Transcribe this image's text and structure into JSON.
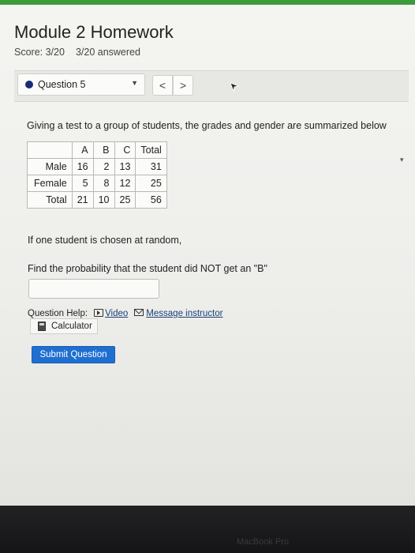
{
  "page": {
    "title": "Module 2 Homework",
    "score": "Score: 3/20",
    "answered": "3/20 answered"
  },
  "question_nav": {
    "selected": "Question 5",
    "caret": "▼",
    "prev": "<",
    "next": ">"
  },
  "question": {
    "intro": "Giving a test to a group of students, the grades and gender are summarized below",
    "table": {
      "headers": [
        "",
        "A",
        "B",
        "C",
        "Total"
      ],
      "rows": [
        [
          "Male",
          "16",
          "2",
          "13",
          "31"
        ],
        [
          "Female",
          "5",
          "8",
          "12",
          "25"
        ],
        [
          "Total",
          "21",
          "10",
          "25",
          "56"
        ]
      ]
    },
    "prompt1": "If one student is chosen at random,",
    "prompt2": "Find the probability that the student did NOT get an \"B\"",
    "answer_value": ""
  },
  "help": {
    "label": "Question Help:",
    "video": "Video",
    "message": "Message instructor",
    "calculator": "Calculator"
  },
  "submit_label": "Submit Question",
  "device_label": "MacBook Pro",
  "colors": {
    "accent": "#3d9a3a",
    "submit": "#1f6fd1",
    "question_dot": "#1a2a7a"
  }
}
